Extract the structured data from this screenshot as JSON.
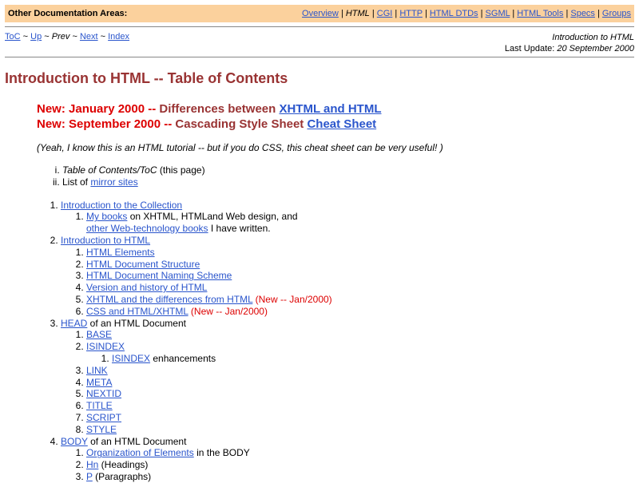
{
  "topbar": {
    "label": "Other Documentation Areas:",
    "links": {
      "overview": "Overview",
      "html": "HTML",
      "cgi": "CGI",
      "http": "HTTP",
      "dtds": "HTML DTDs",
      "sgml": "SGML",
      "tools": "HTML Tools",
      "specs": "Specs",
      "groups": "Groups"
    },
    "separator": "|",
    "background": "#fbd19d"
  },
  "subnav": {
    "toc": "ToC",
    "up": "Up",
    "prev": "Prev",
    "next": "Next",
    "index": "Index",
    "separator": "~"
  },
  "pageinfo": {
    "doc_title": "Introduction to HTML",
    "last_update_label": "Last Update:",
    "last_update_date": "20 September 2000"
  },
  "title": "Introduction to HTML -- Table of Contents",
  "news": [
    {
      "new": "New: January 2000 --",
      "text": " Differences between ",
      "link": "XHTML and HTML"
    },
    {
      "new": "New: September 2000 --",
      "text": " Cascading Style Sheet ",
      "link": "Cheat Sheet"
    }
  ],
  "note": "(Yeah, I know this is an HTML tutorial -- but if you do CSS, this cheat sheet can be very useful! )",
  "roman": [
    {
      "italic": "Table of Contents/ToC",
      "rest": " (this page)"
    },
    {
      "pre": "List of ",
      "link": "mirror sites"
    }
  ],
  "toc": {
    "s1": {
      "link": "Introduction to the Collection",
      "sub1_link": "My books",
      "sub1_text": " on XHTML, HTMLand Web design, and",
      "sub1_link2": "other Web-technology books",
      "sub1_text2": " I have written."
    },
    "s2": {
      "link": "Introduction to HTML",
      "items": [
        "HTML Elements",
        "HTML Document Structure",
        "HTML Document Naming Scheme",
        "Version and history of HTML",
        "XHTML and the differences from HTML",
        "CSS and HTML/XHTML"
      ],
      "new_tag": " (New -- Jan/2000)"
    },
    "s3": {
      "link": "HEAD",
      "text": " of an HTML Document",
      "base": "BASE",
      "isindex": "ISINDEX",
      "isindex_sub_link": "ISINDEX",
      "isindex_sub_text": " enhancements",
      "items": [
        "LINK",
        "META",
        "NEXTID",
        "TITLE",
        "SCRIPT",
        "STYLE"
      ]
    },
    "s4": {
      "link": "BODY",
      "text": " of an HTML Document",
      "org_link": "Organization of Elements",
      "org_text": " in the BODY",
      "hn_link": "Hn",
      "hn_text": " (Headings)",
      "p_link": "P",
      "p_text": " (Paragraphs)"
    }
  }
}
